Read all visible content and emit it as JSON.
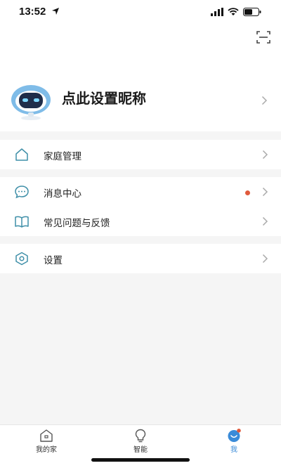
{
  "status_bar": {
    "time": "13:52"
  },
  "profile": {
    "nickname": "点此设置昵称"
  },
  "menu_groups": [
    {
      "items": [
        {
          "label": "家庭管理",
          "icon": "home-icon"
        }
      ]
    },
    {
      "items": [
        {
          "label": "消息中心",
          "icon": "message-icon",
          "badge": "dot"
        },
        {
          "label": "常见问题与反馈",
          "icon": "book-icon"
        }
      ]
    },
    {
      "items": [
        {
          "label": "设置",
          "icon": "settings-icon"
        }
      ]
    }
  ],
  "tabbar": {
    "tabs": [
      {
        "label": "我的家",
        "icon": "home-tab-icon",
        "active": false
      },
      {
        "label": "智能",
        "icon": "bulb-tab-icon",
        "active": false
      },
      {
        "label": "我",
        "icon": "me-tab-icon",
        "active": true
      }
    ]
  },
  "colors": {
    "accent": "#3a8bd8",
    "icon_teal": "#3f8fa8",
    "badge_red": "#e05a3c",
    "background": "#f5f5f5"
  }
}
